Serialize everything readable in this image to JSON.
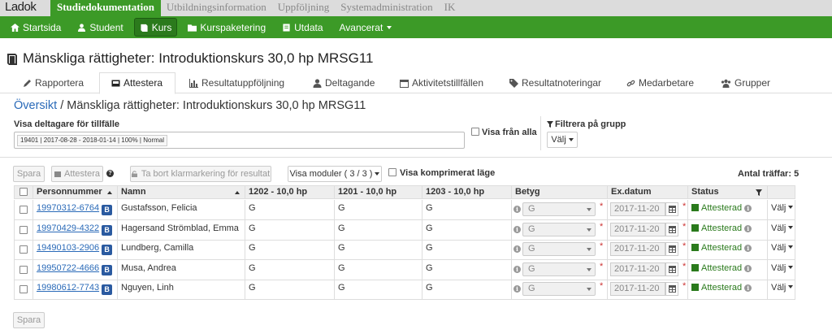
{
  "app": {
    "logo": "Ladok",
    "top_nav": [
      "Studiedokumentation",
      "Utbildningsinformation",
      "Uppföljning",
      "Systemadministration",
      "IK"
    ],
    "main_nav": [
      {
        "label": "Startsida",
        "icon": "home-icon"
      },
      {
        "label": "Student",
        "icon": "user-icon"
      },
      {
        "label": "Kurs",
        "icon": "book-icon"
      },
      {
        "label": "Kurspaketering",
        "icon": "folder-icon"
      },
      {
        "label": "Utdata",
        "icon": "document-icon"
      },
      {
        "label": "Avancerat",
        "icon": "caret-down-icon"
      }
    ]
  },
  "page": {
    "title": "Mänskliga rättigheter: Introduktionskurs 30,0 hp MRSG11",
    "tabs": [
      {
        "label": "Rapportera",
        "icon": "pencil-icon"
      },
      {
        "label": "Attestera",
        "icon": "inbox-icon"
      },
      {
        "label": "Resultatuppföljning",
        "icon": "bar-chart-icon"
      },
      {
        "label": "Deltagande",
        "icon": "user-icon"
      },
      {
        "label": "Aktivitetstillfällen",
        "icon": "calendar-icon"
      },
      {
        "label": "Resultatnoteringar",
        "icon": "tag-icon"
      },
      {
        "label": "Medarbetare",
        "icon": "link-icon"
      },
      {
        "label": "Grupper",
        "icon": "group-icon"
      }
    ],
    "breadcrumb_link": "Översikt",
    "breadcrumb_sep": "/",
    "breadcrumb_current": "Mänskliga rättigheter: Introduktionskurs 30,0 hp MRSG11"
  },
  "filters": {
    "visa_deltagare_label": "Visa deltagare för tillfälle",
    "tillfalle_value": "19401 | 2017-08-28 - 2018-01-14 | 100% | Normal",
    "visa_fran_alla": "Visa från alla",
    "filtrera_label": "Filtrera på grupp",
    "valj": "Välj"
  },
  "toolbar": {
    "spara": "Spara",
    "attestera": "Attestera",
    "ta_bort": "Ta bort klarmarkering för resultat",
    "visa_moduler": "Visa moduler ( 3 / 3 )",
    "visa_komprimerat": "Visa komprimerat läge",
    "antal_traffar_label": "Antal träffar:",
    "antal_traffar_value": "5"
  },
  "table": {
    "headers": [
      "Personnummer",
      "Namn",
      "1202 - 10,0 hp",
      "1201 - 10,0 hp",
      "1203 - 10,0 hp",
      "Betyg",
      "Ex.datum",
      "Status"
    ],
    "rows": [
      {
        "pnr": "19970312-6764",
        "name": "Gustafsson, Felicia",
        "m1202": "G",
        "m1201": "G",
        "m1203": "G",
        "betyg": "G",
        "date": "2017-11-20",
        "status": "Attesterad",
        "action": "Välj"
      },
      {
        "pnr": "19970429-4322",
        "name": "Hagersand Strömblad, Emma",
        "m1202": "G",
        "m1201": "G",
        "m1203": "G",
        "betyg": "G",
        "date": "2017-11-20",
        "status": "Attesterad",
        "action": "Välj"
      },
      {
        "pnr": "19490103-2906",
        "name": "Lundberg, Camilla",
        "m1202": "G",
        "m1201": "G",
        "m1203": "G",
        "betyg": "G",
        "date": "2017-11-20",
        "status": "Attesterad",
        "action": "Välj"
      },
      {
        "pnr": "19950722-4666",
        "name": "Musa, Andrea",
        "m1202": "G",
        "m1201": "G",
        "m1203": "G",
        "betyg": "G",
        "date": "2017-11-20",
        "status": "Attesterad",
        "action": "Välj"
      },
      {
        "pnr": "19980612-7743",
        "name": "Nguyen, Linh",
        "m1202": "G",
        "m1201": "G",
        "m1203": "G",
        "betyg": "G",
        "date": "2017-11-20",
        "status": "Attesterad",
        "action": "Välj"
      }
    ],
    "badge": "B",
    "required_mark": "*"
  },
  "footer": {
    "spara": "Spara"
  },
  "colors": {
    "brand_green": "#3c9a27",
    "link_blue": "#2a6ab8",
    "badge_blue": "#2a5aa0"
  }
}
